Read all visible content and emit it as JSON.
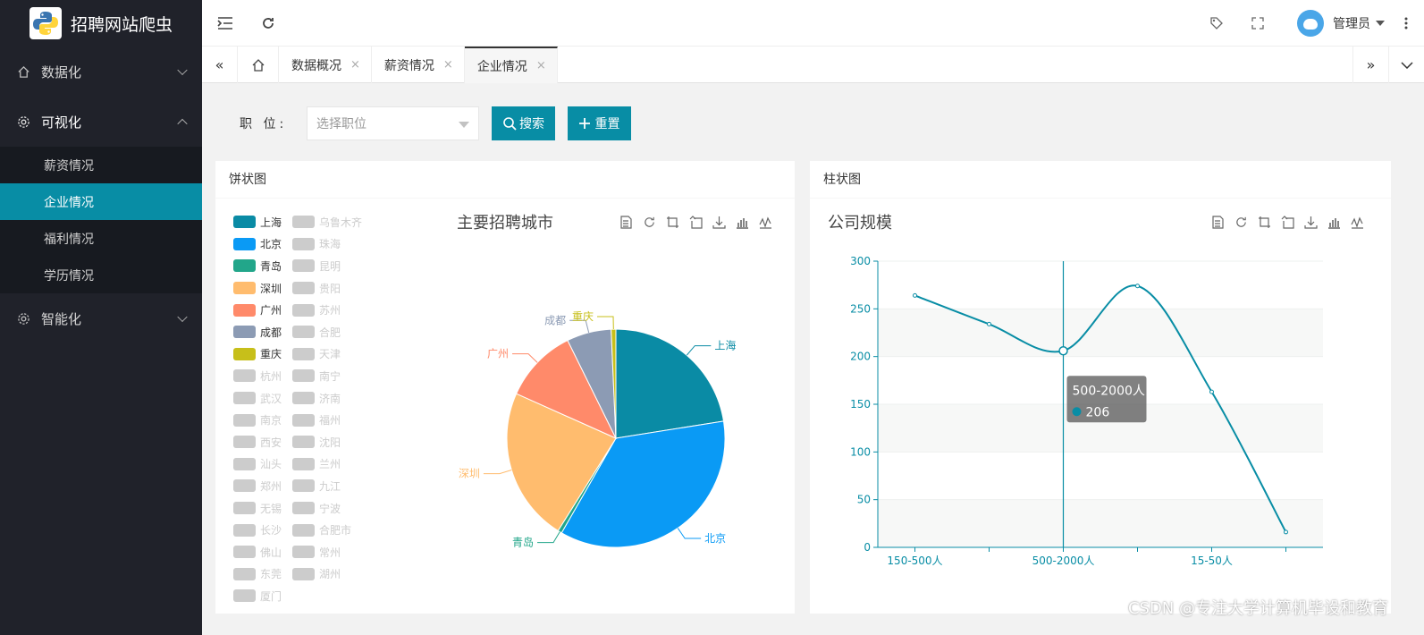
{
  "app": {
    "title": "招聘网站爬虫"
  },
  "sidebar": {
    "items": [
      {
        "label": "数据化",
        "icon": "home-icon",
        "open": false
      },
      {
        "label": "可视化",
        "icon": "gear-icon",
        "open": true,
        "children": [
          {
            "label": "薪资情况",
            "active": false
          },
          {
            "label": "企业情况",
            "active": true
          },
          {
            "label": "福利情况",
            "active": false
          },
          {
            "label": "学历情况",
            "active": false
          }
        ]
      },
      {
        "label": "智能化",
        "icon": "gear-icon",
        "open": false
      }
    ]
  },
  "header": {
    "user_name": "管理员"
  },
  "tabs": [
    {
      "label": "数据概况",
      "close": "×",
      "active": false
    },
    {
      "label": "薪资情况",
      "close": "×",
      "active": false
    },
    {
      "label": "企业情况",
      "close": "×",
      "active": true
    }
  ],
  "search": {
    "label": "职  位:",
    "placeholder": "选择职位",
    "search_button": "搜索",
    "reset_button": "重置"
  },
  "pie_card": {
    "header": "饼状图"
  },
  "bar_card": {
    "header": "柱状图"
  },
  "colors": {
    "accent": "#088da5",
    "sidebar_bg": "#20222a"
  },
  "chart_data": [
    {
      "type": "pie",
      "title": "主要招聘城市",
      "legend": [
        {
          "name": "上海",
          "color": "#0a8ba5",
          "active": true
        },
        {
          "name": "乌鲁木齐",
          "active": false
        },
        {
          "name": "北京",
          "color": "#0a9af5",
          "active": true
        },
        {
          "name": "珠海",
          "active": false
        },
        {
          "name": "青岛",
          "color": "#22a68a",
          "active": true
        },
        {
          "name": "昆明",
          "active": false
        },
        {
          "name": "深圳",
          "color": "#ffbc6e",
          "active": true
        },
        {
          "name": "贵阳",
          "active": false
        },
        {
          "name": "广州",
          "color": "#ff8a6a",
          "active": true
        },
        {
          "name": "苏州",
          "active": false
        },
        {
          "name": "成都",
          "color": "#8c9bb4",
          "active": true
        },
        {
          "name": "合肥",
          "active": false
        },
        {
          "name": "重庆",
          "color": "#c7bf1a",
          "active": true
        },
        {
          "name": "天津",
          "active": false
        },
        {
          "name": "杭州",
          "active": false
        },
        {
          "name": "南宁",
          "active": false
        },
        {
          "name": "武汉",
          "active": false
        },
        {
          "name": "济南",
          "active": false
        },
        {
          "name": "南京",
          "active": false
        },
        {
          "name": "福州",
          "active": false
        },
        {
          "name": "西安",
          "active": false
        },
        {
          "name": "沈阳",
          "active": false
        },
        {
          "name": "汕头",
          "active": false
        },
        {
          "name": "兰州",
          "active": false
        },
        {
          "name": "郑州",
          "active": false
        },
        {
          "name": "九江",
          "active": false
        },
        {
          "name": "无锡",
          "active": false
        },
        {
          "name": "宁波",
          "active": false
        },
        {
          "name": "长沙",
          "active": false
        },
        {
          "name": "合肥市",
          "active": false
        },
        {
          "name": "佛山",
          "active": false
        },
        {
          "name": "常州",
          "active": false
        },
        {
          "name": "东莞",
          "active": false
        },
        {
          "name": "湖州",
          "active": false
        },
        {
          "name": "厦门",
          "active": false
        }
      ],
      "slices": [
        {
          "name": "上海",
          "value": 22.5,
          "color": "#0a8ba5"
        },
        {
          "name": "北京",
          "value": 35.8,
          "color": "#0a9af5"
        },
        {
          "name": "青岛",
          "value": 0.6,
          "color": "#22a68a"
        },
        {
          "name": "深圳",
          "value": 22.8,
          "color": "#ffbc6e"
        },
        {
          "name": "广州",
          "value": 11.0,
          "color": "#ff8a6a"
        },
        {
          "name": "成都",
          "value": 6.6,
          "color": "#8c9bb4"
        },
        {
          "name": "重庆",
          "value": 0.7,
          "color": "#c7bf1a"
        }
      ]
    },
    {
      "type": "line",
      "title": "公司规模",
      "categories": [
        "150-500人",
        "",
        "500-2000人",
        "",
        "15-50人",
        ""
      ],
      "values": [
        264,
        234,
        206,
        274,
        163,
        16
      ],
      "ylim": [
        0,
        300
      ],
      "yticks": [
        0,
        50,
        100,
        150,
        200,
        250,
        300
      ],
      "tooltip": {
        "label": "500-2000人",
        "value": "206"
      },
      "color": "#088da5"
    }
  ],
  "watermark": "CSDN @专注大学计算机毕设和教育"
}
